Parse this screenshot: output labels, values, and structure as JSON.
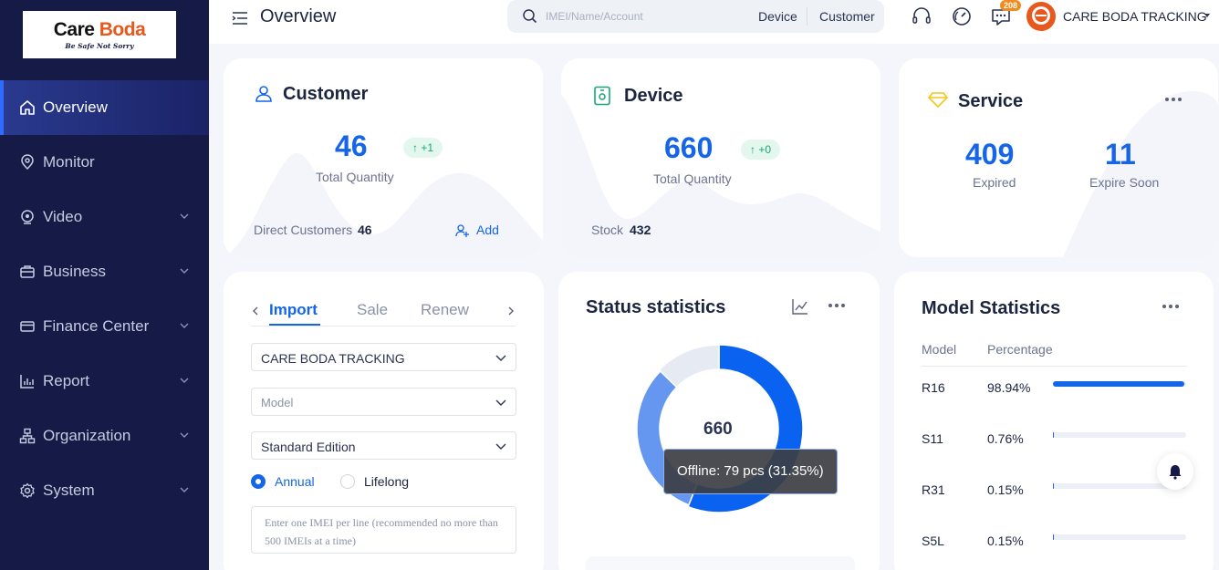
{
  "brand": {
    "part1": "Care ",
    "part2": "Boda",
    "tagline": "Be Safe Not Sorry"
  },
  "sidebar": {
    "items": [
      {
        "label": "Overview",
        "icon": "home-icon",
        "active": true
      },
      {
        "label": "Monitor",
        "icon": "location-pin-icon"
      },
      {
        "label": "Video",
        "icon": "video-icon"
      },
      {
        "label": "Business",
        "icon": "briefcase-icon"
      },
      {
        "label": "Finance Center",
        "icon": "credit-card-icon"
      },
      {
        "label": "Report",
        "icon": "bar-chart-icon"
      },
      {
        "label": "Organization",
        "icon": "org-chart-icon"
      },
      {
        "label": "System",
        "icon": "gear-icon"
      }
    ]
  },
  "header": {
    "title": "Overview",
    "search_placeholder": "IMEI/Name/Account",
    "search_opt1": "Device",
    "search_opt2": "Customer",
    "message_count": "208",
    "user_name": "CARE BODA TRACKING"
  },
  "customer_card": {
    "title": "Customer",
    "total": "46",
    "delta": "↑ +1",
    "total_label": "Total Quantity",
    "direct_label": "Direct Customers",
    "direct_value": "46",
    "add_label": "Add"
  },
  "device_card": {
    "title": "Device",
    "total": "660",
    "delta": "↑ +0",
    "total_label": "Total Quantity",
    "stock_label": "Stock",
    "stock_value": "432"
  },
  "service_card": {
    "title": "Service",
    "expired_value": "409",
    "expired_label": "Expired",
    "expire_soon_value": "11",
    "expire_soon_label": "Expire Soon"
  },
  "import_card": {
    "tabs": [
      "Import",
      "Sale",
      "Renew"
    ],
    "account_select": "CARE BODA TRACKING",
    "model_placeholder": "Model",
    "edition_select": "Standard Edition",
    "radio_annual": "Annual",
    "radio_lifelong": "Lifelong",
    "imei_placeholder": "Enter one IMEI per line (recommended no more than 500 IMEIs at a time)"
  },
  "status_card": {
    "title": "Status statistics",
    "center_value": "660",
    "tooltip": "Offline: 79 pcs (31.35%)"
  },
  "chart_data": {
    "type": "pie",
    "title": "Status statistics",
    "total": 660,
    "slices": [
      {
        "label": "",
        "fraction": 0.56,
        "color": "#0a63f0"
      },
      {
        "label": "Offline",
        "fraction": 0.3135,
        "color": "#6597f0"
      },
      {
        "label": "",
        "fraction": 0.1265,
        "color": "#e6eaf3"
      }
    ]
  },
  "model_card": {
    "title": "Model Statistics",
    "col_model": "Model",
    "col_percentage": "Percentage",
    "rows": [
      {
        "model": "R16",
        "pct": "98.94%",
        "value": 98.94
      },
      {
        "model": "S11",
        "pct": "0.76%",
        "value": 0.76
      },
      {
        "model": "R31",
        "pct": "0.15%",
        "value": 0.15
      },
      {
        "model": "S5L",
        "pct": "0.15%",
        "value": 0.15
      }
    ]
  },
  "colors": {
    "accent": "#1565e8",
    "sidebar": "#151a47",
    "success": "#15a874"
  }
}
